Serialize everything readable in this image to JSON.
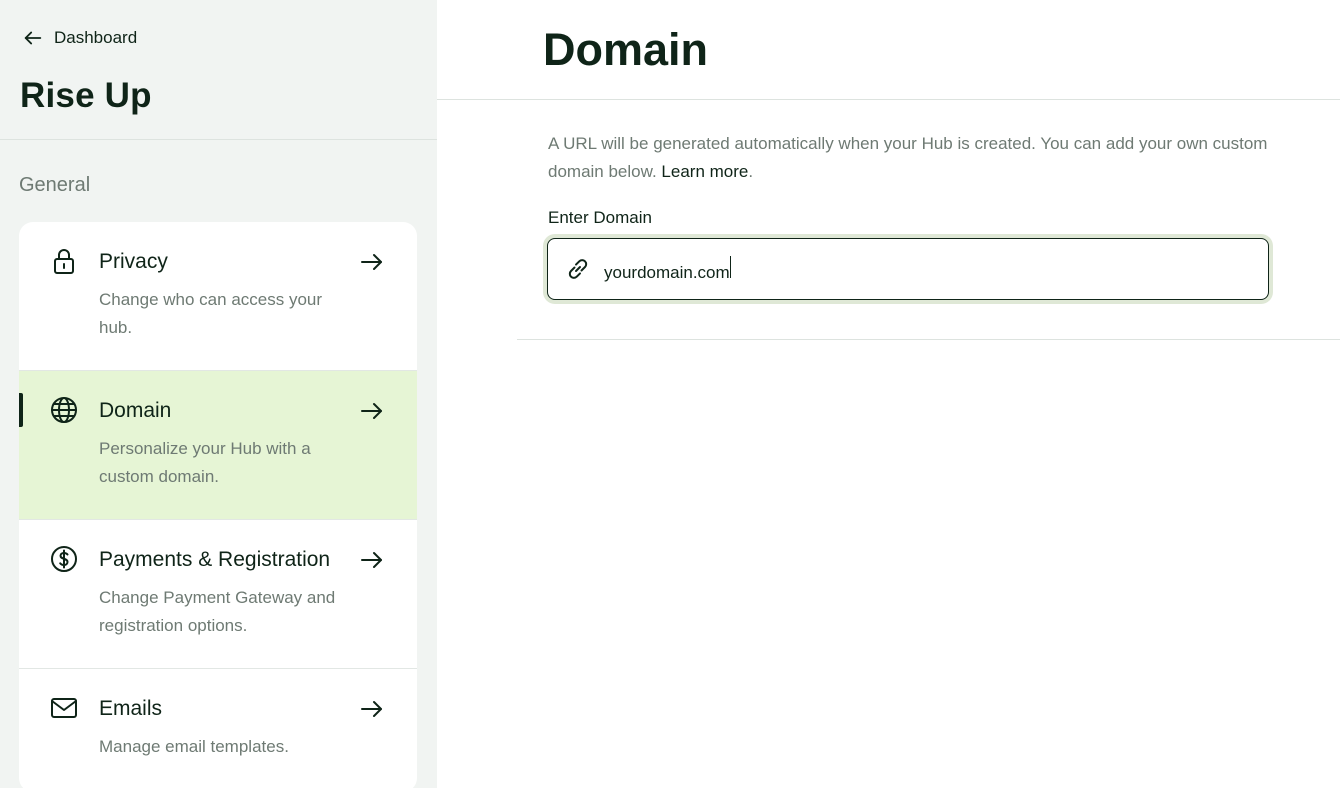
{
  "sidebar": {
    "back_label": "Dashboard",
    "hub_title": "Rise Up",
    "section_label": "General",
    "items": [
      {
        "title": "Privacy",
        "desc": "Change who can access your hub.",
        "icon": "lock-icon"
      },
      {
        "title": "Domain",
        "desc": "Personalize your Hub with a custom domain.",
        "icon": "globe-icon"
      },
      {
        "title": "Payments & Registration",
        "desc": "Change Payment Gateway and registration options.",
        "icon": "dollar-icon"
      },
      {
        "title": "Emails",
        "desc": "Manage email templates.",
        "icon": "mail-icon"
      }
    ]
  },
  "main": {
    "title": "Domain",
    "info_text": "A URL will be generated automatically when your Hub is created. You can add your own custom domain below.",
    "learn_more": "Learn more",
    "field_label": "Enter Domain",
    "domain_value": "yourdomain.com"
  },
  "colors": {
    "accent_bg": "#e6f5d5",
    "text_dark": "#0f2418",
    "text_muted": "#6e7a73",
    "sidebar_bg": "#f1f4f2"
  }
}
